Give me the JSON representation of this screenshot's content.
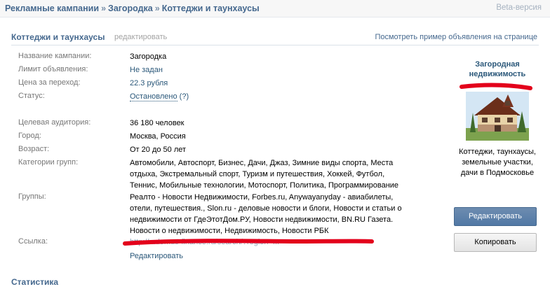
{
  "breadcrumbs": [
    "Рекламные кампании",
    "Загородка",
    "Коттеджи и таунхаусы"
  ],
  "separator": "»",
  "beta_label": "Beta-версия",
  "section": {
    "title": "Коттеджи и таунхаусы",
    "edit_label": "редактировать",
    "preview_link": "Посмотреть пример объявления на странице"
  },
  "fields": {
    "campaign": {
      "label": "Название кампании:",
      "value": "Загородка"
    },
    "limit": {
      "label": "Лимит объявления:",
      "value": "Не задан"
    },
    "price": {
      "label": "Цена за переход:",
      "value": "22.3 рубля"
    },
    "status": {
      "label": "Статус:",
      "value": "Остановлено",
      "hint": "(?)"
    },
    "audience": {
      "label": "Целевая аудитория:",
      "value": "36 180 человек"
    },
    "city": {
      "label": "Город:",
      "value": "Москва, Россия"
    },
    "age": {
      "label": "Возраст:",
      "value": "От 20 до 50 лет"
    },
    "categories": {
      "label": "Категории групп:",
      "value": "Автомобили, Автоспорт, Бизнес, Дачи, Джаз, Зимние виды спорта, Места отдыха, Экстремальный спорт, Туризм и путешествия, Хоккей, Футбол, Теннис, Мобильные технологии, Мотоспорт, Политика, Программирование"
    },
    "groups": {
      "label": "Группы:",
      "value": "Реалто - Новости Недвижимости, Forbes.ru, Anywayanyday - авиабилеты, отели, путешествия., Slon.ru - деловые новости и блоги, Новости и статьи о недвижимости от ГдеЭтотДом.РУ, Новости недвижимости, BN.RU Газета. Новости о недвижимости, Недвижимость, Новости РБК"
    },
    "link": {
      "label": "Ссылка:",
      "value": "http://...domus-finance.ru/search/?region=...",
      "edit": "Редактировать"
    }
  },
  "ad": {
    "title": "Загородная недвижимость",
    "text": "Коттеджи, таунхаусы, земельные участки, дачи в Подмосковье"
  },
  "buttons": {
    "edit": "Редактировать",
    "copy": "Копировать"
  },
  "stats_title": "Статистика",
  "colors": {
    "link": "#2b587a",
    "header": "#45688e",
    "label": "#777777",
    "redaction": "#e3001b"
  }
}
